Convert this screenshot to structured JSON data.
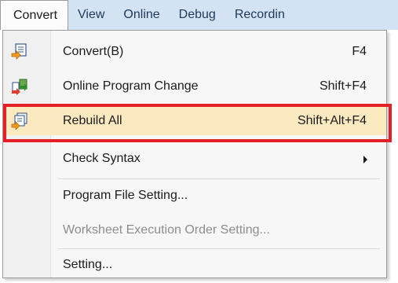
{
  "menubar": {
    "items": [
      {
        "label": "Convert"
      },
      {
        "label": "View"
      },
      {
        "label": "Online"
      },
      {
        "label": "Debug"
      },
      {
        "label": "Recordin"
      }
    ]
  },
  "menu": {
    "items": [
      {
        "label": "Convert(B)",
        "shortcut": "F4",
        "icon": "convert-icon"
      },
      {
        "label": "Online Program Change",
        "shortcut": "Shift+F4",
        "icon": "online-program-change-icon"
      },
      {
        "label": "Rebuild All",
        "shortcut": "Shift+Alt+F4",
        "icon": "rebuild-all-icon",
        "highlighted": true
      },
      {
        "label": "Check Syntax",
        "submenu": true
      },
      {
        "label": "Program File Setting..."
      },
      {
        "label": "Worksheet Execution Order Setting...",
        "disabled": true
      },
      {
        "label": "Setting..."
      }
    ]
  },
  "colors": {
    "menubar_bg": "#d4e3f3",
    "highlight_frame": "#e41f26",
    "hover_bg": "#fbe9c0",
    "disabled_text": "#8d8d8d"
  }
}
